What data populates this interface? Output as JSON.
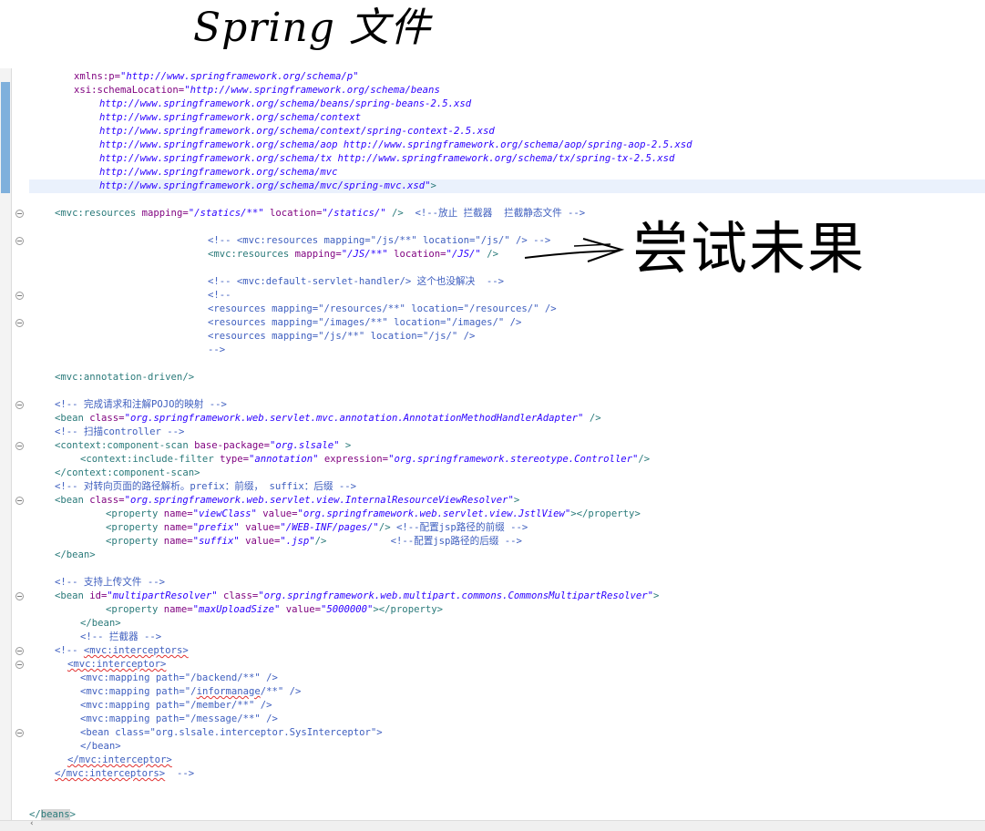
{
  "annotations": {
    "title": "Spring 文件",
    "note": "尝试未果"
  },
  "editor": {
    "lines": [
      [
        {
          "c": "attr",
          "t": "xmlns:p="
        },
        {
          "c": "str",
          "t": "\"http://www.springframework.org/schema/p\""
        }
      ],
      [
        {
          "c": "attr",
          "t": "xsi:schemaLocation="
        },
        {
          "c": "str",
          "t": "\"http://www.springframework.org/schema/beans"
        }
      ],
      [
        {
          "c": "str",
          "t": "http://www.springframework.org/schema/beans/spring-beans-2.5.xsd"
        }
      ],
      [
        {
          "c": "str",
          "t": "http://www.springframework.org/schema/context"
        }
      ],
      [
        {
          "c": "str",
          "t": "http://www.springframework.org/schema/context/spring-context-2.5.xsd"
        }
      ],
      [
        {
          "c": "str",
          "t": "http://www.springframework.org/schema/aop http://www.springframework.org/schema/aop/spring-aop-2.5.xsd"
        }
      ],
      [
        {
          "c": "str",
          "t": "http://www.springframework.org/schema/tx http://www.springframework.org/schema/tx/spring-tx-2.5.xsd"
        }
      ],
      [
        {
          "c": "str",
          "t": "http://www.springframework.org/schema/mvc"
        }
      ],
      [
        {
          "c": "str",
          "t": "http://www.springframework.org/schema/mvc/spring-mvc.xsd\""
        },
        {
          "c": "tag",
          "t": ">"
        }
      ],
      [],
      [
        {
          "c": "tag",
          "t": "<mvc:resources "
        },
        {
          "c": "attr",
          "t": "mapping="
        },
        {
          "c": "str",
          "t": "\"/statics/**\""
        },
        {
          "c": "t",
          "t": " "
        },
        {
          "c": "attr",
          "t": "location="
        },
        {
          "c": "str",
          "t": "\"/statics/\""
        },
        {
          "c": "tag",
          "t": " />"
        },
        {
          "c": "t",
          "t": "  "
        },
        {
          "c": "cmt",
          "t": "<!--放止 拦截器  拦截静态文件 -->"
        }
      ],
      [],
      [
        {
          "c": "cmt",
          "t": "<!-- <mvc:resources mapping=\"/js/**\" location=\"/js/\" /> -->"
        }
      ],
      [
        {
          "c": "tag",
          "t": "<mvc:resources "
        },
        {
          "c": "attr",
          "t": "mapping="
        },
        {
          "c": "str",
          "t": "\"/JS/**\""
        },
        {
          "c": "t",
          "t": " "
        },
        {
          "c": "attr",
          "t": "location="
        },
        {
          "c": "str",
          "t": "\"/JS/\""
        },
        {
          "c": "tag",
          "t": " />"
        }
      ],
      [],
      [
        {
          "c": "cmt",
          "t": "<!-- <mvc:default-servlet-handler/> 这个也没解决  -->"
        }
      ],
      [
        {
          "c": "cmt",
          "t": "<!--"
        }
      ],
      [
        {
          "c": "cmt",
          "t": "<resources mapping=\"/resources/**\" location=\"/resources/\" />"
        }
      ],
      [
        {
          "c": "cmt",
          "t": "<resources mapping=\"/images/**\" location=\"/images/\" />"
        }
      ],
      [
        {
          "c": "cmt",
          "t": "<resources mapping=\"/js/**\" location=\"/js/\" />"
        }
      ],
      [
        {
          "c": "cmt",
          "t": "-->"
        }
      ],
      [],
      [
        {
          "c": "tag",
          "t": "<mvc:annotation-driven/>"
        }
      ],
      [],
      [
        {
          "c": "cmt",
          "t": "<!-- 完成请求和注解POJO的映射 -->"
        }
      ],
      [
        {
          "c": "tag",
          "t": "<bean "
        },
        {
          "c": "attr",
          "t": "class="
        },
        {
          "c": "str",
          "t": "\"org.springframework.web.servlet.mvc.annotation.AnnotationMethodHandlerAdapter\""
        },
        {
          "c": "tag",
          "t": " />"
        }
      ],
      [
        {
          "c": "cmt",
          "t": "<!-- 扫描controller -->"
        }
      ],
      [
        {
          "c": "tag",
          "t": "<context:component-scan "
        },
        {
          "c": "attr",
          "t": "base-package="
        },
        {
          "c": "str",
          "t": "\"org.slsale\""
        },
        {
          "c": "tag",
          "t": " >"
        }
      ],
      [
        {
          "c": "tag",
          "t": "<context:include-filter "
        },
        {
          "c": "attr",
          "t": "type="
        },
        {
          "c": "str",
          "t": "\"annotation\""
        },
        {
          "c": "t",
          "t": " "
        },
        {
          "c": "attr",
          "t": "expression="
        },
        {
          "c": "str",
          "t": "\"org.springframework.stereotype.Controller\""
        },
        {
          "c": "tag",
          "t": "/>"
        }
      ],
      [
        {
          "c": "tag",
          "t": "</context:component-scan>"
        }
      ],
      [
        {
          "c": "cmt",
          "t": "<!-- 对转向页面的路径解析。prefix：前缀， suffix：后缀 -->"
        }
      ],
      [
        {
          "c": "tag",
          "t": "<bean "
        },
        {
          "c": "attr",
          "t": "class="
        },
        {
          "c": "str",
          "t": "\"org.springframework.web.servlet.view.InternalResourceViewResolver\""
        },
        {
          "c": "tag",
          "t": ">"
        }
      ],
      [
        {
          "c": "tag",
          "t": "<property "
        },
        {
          "c": "attr",
          "t": "name="
        },
        {
          "c": "str",
          "t": "\"viewClass\""
        },
        {
          "c": "t",
          "t": " "
        },
        {
          "c": "attr",
          "t": "value="
        },
        {
          "c": "str",
          "t": "\"org.springframework.web.servlet.view.JstlView\""
        },
        {
          "c": "tag",
          "t": "></property>"
        }
      ],
      [
        {
          "c": "tag",
          "t": "<property "
        },
        {
          "c": "attr",
          "t": "name="
        },
        {
          "c": "str",
          "t": "\"prefix\""
        },
        {
          "c": "t",
          "t": " "
        },
        {
          "c": "attr",
          "t": "value="
        },
        {
          "c": "str",
          "t": "\"/WEB-INF/pages/\""
        },
        {
          "c": "tag",
          "t": "/>"
        },
        {
          "c": "t",
          "t": " "
        },
        {
          "c": "cmt",
          "t": "<!--配置jsp路径的前缀 -->"
        }
      ],
      [
        {
          "c": "tag",
          "t": "<property "
        },
        {
          "c": "attr",
          "t": "name="
        },
        {
          "c": "str",
          "t": "\"suffix\""
        },
        {
          "c": "t",
          "t": " "
        },
        {
          "c": "attr",
          "t": "value="
        },
        {
          "c": "str",
          "t": "\".jsp\""
        },
        {
          "c": "tag",
          "t": "/>"
        },
        {
          "c": "t",
          "t": "           "
        },
        {
          "c": "cmt",
          "t": "<!--配置jsp路径的后缀 -->"
        }
      ],
      [
        {
          "c": "tag",
          "t": "</bean>"
        }
      ],
      [],
      [
        {
          "c": "cmt",
          "t": "<!-- 支持上传文件 -->"
        }
      ],
      [
        {
          "c": "tag",
          "t": "<bean "
        },
        {
          "c": "attr",
          "t": "id="
        },
        {
          "c": "str",
          "t": "\"multipartResolver\""
        },
        {
          "c": "t",
          "t": " "
        },
        {
          "c": "attr",
          "t": "class="
        },
        {
          "c": "str",
          "t": "\"org.springframework.web.multipart.commons.CommonsMultipartResolver\""
        },
        {
          "c": "tag",
          "t": ">"
        }
      ],
      [
        {
          "c": "tag",
          "t": "<property "
        },
        {
          "c": "attr",
          "t": "name="
        },
        {
          "c": "str",
          "t": "\"maxUploadSize\""
        },
        {
          "c": "t",
          "t": " "
        },
        {
          "c": "attr",
          "t": "value="
        },
        {
          "c": "str",
          "t": "\"5000000\""
        },
        {
          "c": "tag",
          "t": "></property>"
        }
      ],
      [
        {
          "c": "tag",
          "t": "</bean>"
        }
      ],
      [
        {
          "c": "cmt",
          "t": "<!-- 拦截器 -->"
        }
      ],
      [
        {
          "c": "cmt",
          "t": "<!-- "
        },
        {
          "c": "cmtsq",
          "t": "<mvc:interceptors>"
        }
      ],
      [
        {
          "c": "cmtsq",
          "t": "<mvc:interceptor>"
        }
      ],
      [
        {
          "c": "cmt",
          "t": "<mvc:mapping path=\"/backend/**\" />"
        }
      ],
      [
        {
          "c": "cmt",
          "t": "<mvc:mapping path=\"/"
        },
        {
          "c": "cmtsq",
          "t": "informanage"
        },
        {
          "c": "cmt",
          "t": "/**\" />"
        }
      ],
      [
        {
          "c": "cmt",
          "t": "<mvc:mapping path=\"/member/**\" />"
        }
      ],
      [
        {
          "c": "cmt",
          "t": "<mvc:mapping path=\"/message/**\" />"
        }
      ],
      [
        {
          "c": "cmt",
          "t": "<bean class=\"org.slsale.interceptor.SysInterceptor\">"
        }
      ],
      [
        {
          "c": "cmt",
          "t": "</bean>"
        }
      ],
      [
        {
          "c": "cmtsq",
          "t": "</mvc:interceptor>"
        }
      ],
      [
        {
          "c": "cmtsq",
          "t": "</mvc:interceptors>"
        },
        {
          "c": "cmt",
          "t": "  -->"
        }
      ],
      [],
      [],
      [
        {
          "c": "tag",
          "t": "</"
        },
        {
          "c": "taghl",
          "t": "beans"
        },
        {
          "c": "tag",
          "t": ">"
        }
      ]
    ]
  }
}
